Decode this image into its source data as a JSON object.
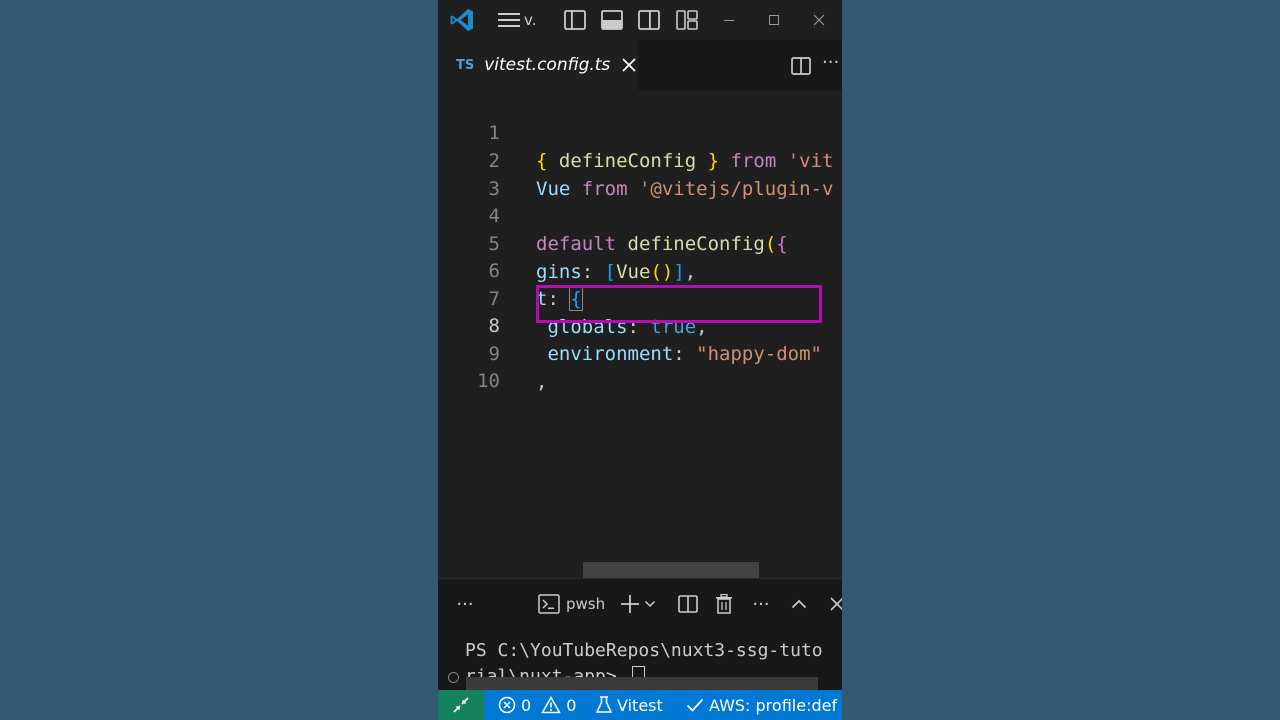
{
  "titlebar": {
    "menu_label": "v."
  },
  "tab": {
    "lang_badge": "TS",
    "filename": "vitest.config.ts"
  },
  "editor": {
    "active_line": 8,
    "lines": [
      {
        "num": "1",
        "tokens": [
          "{ ",
          "defineConfig",
          " } ",
          "from",
          " 'vit"
        ]
      },
      {
        "num": "2",
        "tokens": [
          "Vue",
          " from",
          " '@vitejs/plugin-v"
        ]
      },
      {
        "num": "3",
        "tokens": []
      },
      {
        "num": "4",
        "tokens": [
          "default",
          " ",
          "defineConfig",
          "(",
          "{"
        ]
      },
      {
        "num": "5",
        "tokens": [
          "gins",
          ": ",
          "[",
          "Vue",
          "()",
          "]",
          ","
        ]
      },
      {
        "num": "6",
        "tokens": [
          "t",
          ": ",
          "{"
        ]
      },
      {
        "num": "7",
        "tokens": [
          " globals",
          ": ",
          "true",
          ","
        ]
      },
      {
        "num": "8",
        "tokens": [
          " environment",
          ": ",
          "\"happy-dom\""
        ]
      },
      {
        "num": "9",
        "tokens": [
          ","
        ]
      },
      {
        "num": "10",
        "tokens": []
      }
    ]
  },
  "panel": {
    "shell_label": "pwsh",
    "terminal_line1": "PS C:\\YouTubeRepos\\nuxt3-ssg-tuto",
    "terminal_line2": "rial\\nuxt-app> "
  },
  "statusbar": {
    "errors": "0",
    "warnings": "0",
    "vitest": "Vitest",
    "aws": "AWS: profile:def"
  },
  "colors": {
    "background": "#33566e",
    "editor_bg": "#1f1f1f",
    "status_bar": "#0078d4",
    "remote_indicator": "#16825d",
    "highlight_box": "#b40db4"
  }
}
